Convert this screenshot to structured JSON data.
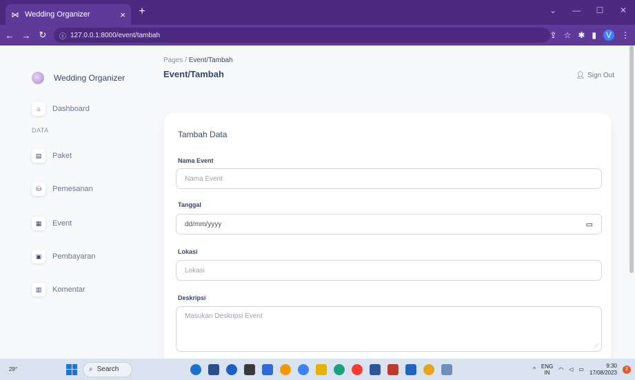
{
  "browser": {
    "tab_title": "Wedding Organizer",
    "tab_close": "×",
    "new_tab": "+",
    "url": "127.0.0.1:8000/event/tambah",
    "min": "—",
    "max": "☐",
    "close": "✕",
    "profile_initial": "V"
  },
  "sidebar": {
    "brand": "Wedding Organizer",
    "heading": "DATA",
    "items": [
      {
        "label": "Dashboard",
        "icon": "⌂"
      },
      {
        "label": "Paket",
        "icon": "▤"
      },
      {
        "label": "Pemesanan",
        "icon": "⛁"
      },
      {
        "label": "Event",
        "icon": "▦"
      },
      {
        "label": "Pembayaran",
        "icon": "▣"
      },
      {
        "label": "Komentar",
        "icon": "▥"
      }
    ]
  },
  "header": {
    "crumb_root": "Pages",
    "crumb_sep": "/",
    "crumb_current": "Event/Tambah",
    "title": "Event/Tambah",
    "signout": "Sign Out"
  },
  "form": {
    "title": "Tambah Data",
    "nama_label": "Nama Event",
    "nama_placeholder": "Nama Event",
    "tanggal_label": "Tanggal",
    "tanggal_value": "dd/mm/yyyy",
    "lokasi_label": "Lokasi",
    "lokasi_placeholder": "Lokasi",
    "deskripsi_label": "Deskripsi",
    "deskripsi_placeholder": "Masukan Deskripsi Event"
  },
  "taskbar": {
    "weather": "29°",
    "search": "Search",
    "lang": "ENG",
    "lang_sub": "IN",
    "time": "9:30",
    "date": "17/08/2023",
    "notif": "2"
  }
}
